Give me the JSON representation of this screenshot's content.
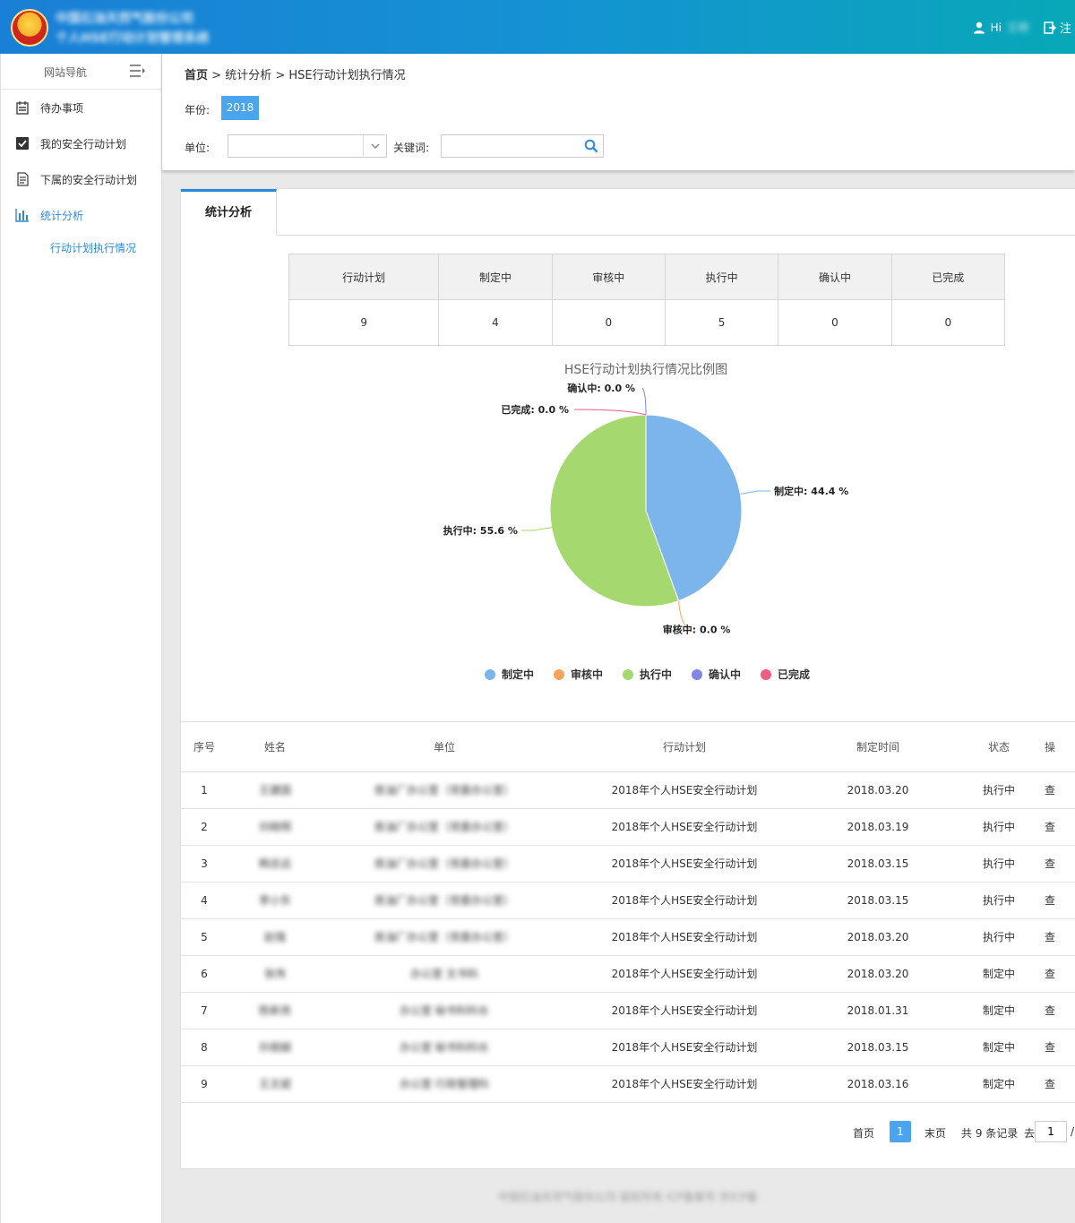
{
  "header": {
    "org_line1": "中国石油天然气股份公司",
    "org_line2": "个人HSE行动计划管理系统",
    "greeting": "Hi",
    "user_name": "王明",
    "logout_label": "注"
  },
  "sidebar": {
    "title": "网站导航",
    "items": [
      {
        "label": "待办事项",
        "icon": "calendar-icon"
      },
      {
        "label": "我的安全行动计划",
        "icon": "checkbox-icon"
      },
      {
        "label": "下属的安全行动计划",
        "icon": "document-icon"
      },
      {
        "label": "统计分析",
        "icon": "bar-chart-icon"
      }
    ],
    "sub_item": "行动计划执行情况"
  },
  "breadcrumb": {
    "home": "首页",
    "sep": ">",
    "section": "统计分析",
    "page": "HSE行动计划执行情况"
  },
  "filters": {
    "year_label": "年份:",
    "year_value": "2018",
    "unit_label": "单位:",
    "unit_value": "",
    "keyword_label": "关键词:",
    "keyword_value": ""
  },
  "tab": {
    "label": "统计分析"
  },
  "summary": {
    "headers": [
      "行动计划",
      "制定中",
      "审核中",
      "执行中",
      "确认中",
      "已完成"
    ],
    "values": [
      "9",
      "4",
      "0",
      "5",
      "0",
      "0"
    ]
  },
  "chart_data": {
    "type": "pie",
    "title": "HSE行动计划执行情况比例图",
    "categories": [
      "制定中",
      "审核中",
      "执行中",
      "确认中",
      "已完成"
    ],
    "values": [
      4,
      0,
      5,
      0,
      0
    ],
    "labels": [
      "制定中: 44.4 %",
      "审核中: 0.0 %",
      "执行中: 55.6 %",
      "确认中: 0.0 %",
      "已完成: 0.0 %"
    ],
    "colors": [
      "#7cb5ec",
      "#f7a35c",
      "#a5d96f",
      "#8085e9",
      "#f15c80"
    ],
    "legend_position": "bottom"
  },
  "table": {
    "headers": [
      "序号",
      "姓名",
      "单位",
      "行动计划",
      "制定时间",
      "状态",
      "操"
    ],
    "rows": [
      {
        "no": "1",
        "name": "王建国",
        "unit": "炼油厂办公室（党委办公室）",
        "plan": "2018年个人HSE安全行动计划",
        "date": "2018.03.20",
        "status": "执行中",
        "op": "查"
      },
      {
        "no": "2",
        "name": "刘晓明",
        "unit": "炼油厂办公室（党委办公室）",
        "plan": "2018年个人HSE安全行动计划",
        "date": "2018.03.19",
        "status": "执行中",
        "op": "查"
      },
      {
        "no": "3",
        "name": "韩志远",
        "unit": "炼油厂办公室（党委办公室）",
        "plan": "2018年个人HSE安全行动计划",
        "date": "2018.03.15",
        "status": "执行中",
        "op": "查"
      },
      {
        "no": "4",
        "name": "李小东",
        "unit": "炼油厂办公室（党委办公室）",
        "plan": "2018年个人HSE安全行动计划",
        "date": "2018.03.15",
        "status": "执行中",
        "op": "查"
      },
      {
        "no": "5",
        "name": "赵强",
        "unit": "炼油厂办公室（党委办公室）",
        "plan": "2018年个人HSE安全行动计划",
        "date": "2018.03.20",
        "status": "执行中",
        "op": "查"
      },
      {
        "no": "6",
        "name": "张伟",
        "unit": "办公室 文书科",
        "plan": "2018年个人HSE安全行动计划",
        "date": "2018.03.20",
        "status": "制定中",
        "op": "查"
      },
      {
        "no": "7",
        "name": "陈新亮",
        "unit": "办公室 秘书科科长",
        "plan": "2018年个人HSE安全行动计划",
        "date": "2018.01.31",
        "status": "制定中",
        "op": "查"
      },
      {
        "no": "8",
        "name": "孙丽娟",
        "unit": "办公室 秘书科科长",
        "plan": "2018年个人HSE安全行动计划",
        "date": "2018.03.15",
        "status": "制定中",
        "op": "查"
      },
      {
        "no": "9",
        "name": "王文斌",
        "unit": "办公室 行政管理科",
        "plan": "2018年个人HSE安全行动计划",
        "date": "2018.03.16",
        "status": "制定中",
        "op": "查"
      }
    ]
  },
  "pager": {
    "first": "首页",
    "current": "1",
    "last": "末页",
    "total": "共 9 条记录",
    "goto": "去",
    "page_input": "1",
    "slash": "/"
  },
  "footer": {
    "text": "中国石油天然气股份公司 版权所有 ICP备案号 京ICP备"
  }
}
